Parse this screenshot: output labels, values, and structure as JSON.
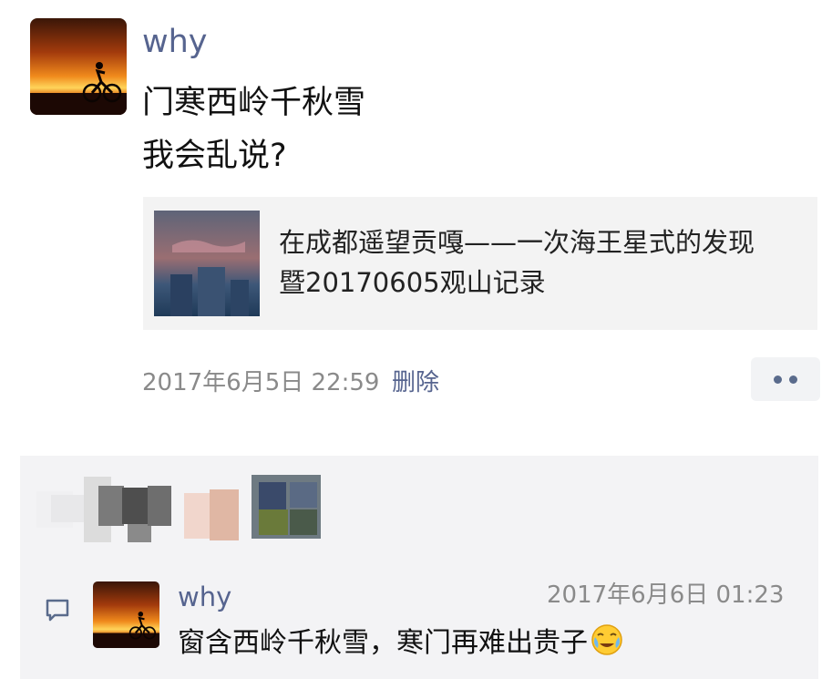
{
  "post": {
    "username": "why",
    "text_lines": [
      "门寒西岭千秋雪",
      "我会乱说?"
    ],
    "link": {
      "title_line1": "在成都遥望贡嘎——一次海王星式的发现",
      "title_line2": "暨20170605观山记录"
    },
    "timestamp": "2017年6月5日 22:59",
    "delete_label": "删除"
  },
  "comment": {
    "username": "why",
    "timestamp": "2017年6月6日 01:23",
    "text": "窗含西岭千秋雪，寒门再难出贵子",
    "emoji_icon": "face-with-tears-icon"
  },
  "likes": {
    "avatars_blurred": true
  },
  "icons": {
    "more": "more-dots-icon",
    "comment": "comment-icon"
  },
  "colors": {
    "name_link": "#56648f",
    "meta_gray": "#8a8a8a",
    "panel_bg": "#f3f3f5"
  }
}
